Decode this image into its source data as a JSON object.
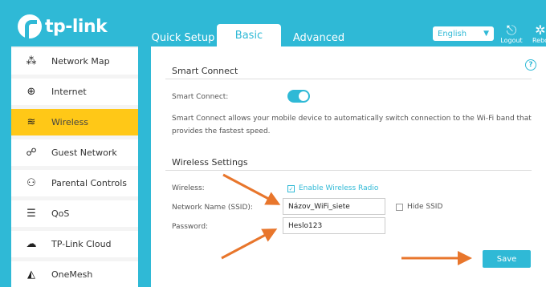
{
  "brand": {
    "name": "tp-link"
  },
  "tabs": {
    "quick": "Quick Setup",
    "basic": "Basic",
    "advanced": "Advanced"
  },
  "header": {
    "language": "English",
    "logout": "Logout",
    "reboot": "Rebo"
  },
  "sidebar": {
    "items": [
      {
        "label": "Network Map",
        "icon": "network-map-icon"
      },
      {
        "label": "Internet",
        "icon": "globe-icon"
      },
      {
        "label": "Wireless",
        "icon": "wifi-icon"
      },
      {
        "label": "Guest Network",
        "icon": "guest-icon"
      },
      {
        "label": "Parental Controls",
        "icon": "parental-icon"
      },
      {
        "label": "QoS",
        "icon": "qos-icon"
      },
      {
        "label": "TP-Link Cloud",
        "icon": "cloud-icon"
      },
      {
        "label": "OneMesh",
        "icon": "onemesh-icon"
      }
    ],
    "active_index": 2
  },
  "smart_connect": {
    "title": "Smart Connect",
    "label": "Smart Connect:",
    "enabled": true,
    "description": "Smart Connect allows your mobile device to automatically switch connection to the Wi-Fi band that provides the fastest speed."
  },
  "wireless_settings": {
    "title": "Wireless Settings",
    "wireless_label": "Wireless:",
    "enable_radio": "Enable Wireless Radio",
    "ssid_label": "Network Name (SSID):",
    "ssid_value": "Názov_WiFi_siete",
    "hide_ssid": "Hide SSID",
    "password_label": "Password:",
    "password_value": "Heslo123"
  },
  "actions": {
    "save": "Save"
  },
  "colors": {
    "accent": "#2fb9d6",
    "active": "#ffc817",
    "arrow": "#e8762c"
  }
}
